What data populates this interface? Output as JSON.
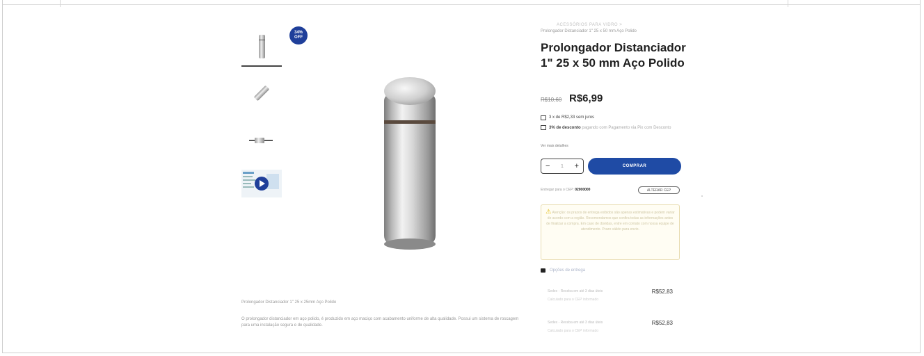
{
  "badge": {
    "line1": "34%",
    "line2": "OFF"
  },
  "video_icon": "play-icon",
  "breadcrumb": {
    "path": "ACESSÓRIOS PARA VIDRO  >",
    "current": "Prolongador Distanciador 1\" 25 x 50 mm Aço Polido"
  },
  "product": {
    "title": "Prolongador Distanciador 1\" 25 x 50 mm Aço Polido",
    "old_price": "R$10,60",
    "price": "R$6,99"
  },
  "payment": {
    "installments": "3 x de R$2,33 sem juros",
    "discount_bold": "3% de desconto",
    "discount_rest": "pagando com Pagamento via Pix com Desconto"
  },
  "more_details": "Ver mais detalhes",
  "quantity": {
    "minus": "−",
    "value": "1",
    "plus": "+"
  },
  "buy_button": "COMPRAR",
  "cep": {
    "label": "Entregar para o CEP: ",
    "value": "02000000",
    "button": "ALTERAR CEP"
  },
  "warning": {
    "icon": "warning-icon",
    "text": "Atenção: os prazos de entrega exibidos são apenas estimativas e podem variar de acordo com a região. Recomendamos que confira todas as informações antes de finalizar a compra. Em caso de dúvidas, entre em contato com nossa equipe de atendimento. Prazo válido para envio."
  },
  "shipping": {
    "header": "Opções de entrega",
    "options": [
      {
        "name": "Sedex - Receba em até 3 dias úteis",
        "price": "R$52,83",
        "sub": "Calculado para o CEP informado"
      },
      {
        "name": "Sedex - Receba em até 3 dias úteis",
        "price": "R$52,83",
        "sub": "Calculado para o CEP informado"
      }
    ]
  },
  "description": {
    "title": "Prolongador Distanciador 1\" 25 x 25mm Aço Polido",
    "text": "O prolongador distanciador em aço polido, é produzido em aço maciço com acabamento uniforme de alta qualidade. Possui um sistema de roscagem para uma instalação segura e de qualidade."
  }
}
